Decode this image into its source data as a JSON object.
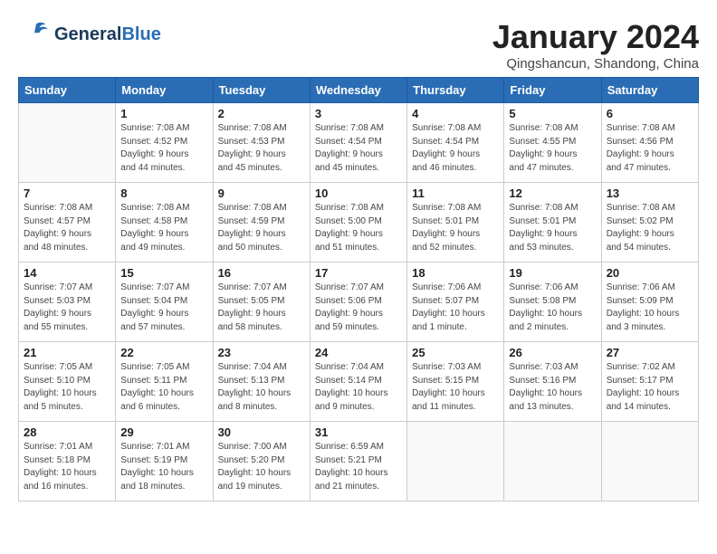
{
  "header": {
    "logo_general": "General",
    "logo_blue": "Blue",
    "month_title": "January 2024",
    "location": "Qingshancun, Shandong, China"
  },
  "days_of_week": [
    "Sunday",
    "Monday",
    "Tuesday",
    "Wednesday",
    "Thursday",
    "Friday",
    "Saturday"
  ],
  "weeks": [
    [
      {
        "day": "",
        "info": ""
      },
      {
        "day": "1",
        "info": "Sunrise: 7:08 AM\nSunset: 4:52 PM\nDaylight: 9 hours\nand 44 minutes."
      },
      {
        "day": "2",
        "info": "Sunrise: 7:08 AM\nSunset: 4:53 PM\nDaylight: 9 hours\nand 45 minutes."
      },
      {
        "day": "3",
        "info": "Sunrise: 7:08 AM\nSunset: 4:54 PM\nDaylight: 9 hours\nand 45 minutes."
      },
      {
        "day": "4",
        "info": "Sunrise: 7:08 AM\nSunset: 4:54 PM\nDaylight: 9 hours\nand 46 minutes."
      },
      {
        "day": "5",
        "info": "Sunrise: 7:08 AM\nSunset: 4:55 PM\nDaylight: 9 hours\nand 47 minutes."
      },
      {
        "day": "6",
        "info": "Sunrise: 7:08 AM\nSunset: 4:56 PM\nDaylight: 9 hours\nand 47 minutes."
      }
    ],
    [
      {
        "day": "7",
        "info": "Sunrise: 7:08 AM\nSunset: 4:57 PM\nDaylight: 9 hours\nand 48 minutes."
      },
      {
        "day": "8",
        "info": "Sunrise: 7:08 AM\nSunset: 4:58 PM\nDaylight: 9 hours\nand 49 minutes."
      },
      {
        "day": "9",
        "info": "Sunrise: 7:08 AM\nSunset: 4:59 PM\nDaylight: 9 hours\nand 50 minutes."
      },
      {
        "day": "10",
        "info": "Sunrise: 7:08 AM\nSunset: 5:00 PM\nDaylight: 9 hours\nand 51 minutes."
      },
      {
        "day": "11",
        "info": "Sunrise: 7:08 AM\nSunset: 5:01 PM\nDaylight: 9 hours\nand 52 minutes."
      },
      {
        "day": "12",
        "info": "Sunrise: 7:08 AM\nSunset: 5:01 PM\nDaylight: 9 hours\nand 53 minutes."
      },
      {
        "day": "13",
        "info": "Sunrise: 7:08 AM\nSunset: 5:02 PM\nDaylight: 9 hours\nand 54 minutes."
      }
    ],
    [
      {
        "day": "14",
        "info": "Sunrise: 7:07 AM\nSunset: 5:03 PM\nDaylight: 9 hours\nand 55 minutes."
      },
      {
        "day": "15",
        "info": "Sunrise: 7:07 AM\nSunset: 5:04 PM\nDaylight: 9 hours\nand 57 minutes."
      },
      {
        "day": "16",
        "info": "Sunrise: 7:07 AM\nSunset: 5:05 PM\nDaylight: 9 hours\nand 58 minutes."
      },
      {
        "day": "17",
        "info": "Sunrise: 7:07 AM\nSunset: 5:06 PM\nDaylight: 9 hours\nand 59 minutes."
      },
      {
        "day": "18",
        "info": "Sunrise: 7:06 AM\nSunset: 5:07 PM\nDaylight: 10 hours\nand 1 minute."
      },
      {
        "day": "19",
        "info": "Sunrise: 7:06 AM\nSunset: 5:08 PM\nDaylight: 10 hours\nand 2 minutes."
      },
      {
        "day": "20",
        "info": "Sunrise: 7:06 AM\nSunset: 5:09 PM\nDaylight: 10 hours\nand 3 minutes."
      }
    ],
    [
      {
        "day": "21",
        "info": "Sunrise: 7:05 AM\nSunset: 5:10 PM\nDaylight: 10 hours\nand 5 minutes."
      },
      {
        "day": "22",
        "info": "Sunrise: 7:05 AM\nSunset: 5:11 PM\nDaylight: 10 hours\nand 6 minutes."
      },
      {
        "day": "23",
        "info": "Sunrise: 7:04 AM\nSunset: 5:13 PM\nDaylight: 10 hours\nand 8 minutes."
      },
      {
        "day": "24",
        "info": "Sunrise: 7:04 AM\nSunset: 5:14 PM\nDaylight: 10 hours\nand 9 minutes."
      },
      {
        "day": "25",
        "info": "Sunrise: 7:03 AM\nSunset: 5:15 PM\nDaylight: 10 hours\nand 11 minutes."
      },
      {
        "day": "26",
        "info": "Sunrise: 7:03 AM\nSunset: 5:16 PM\nDaylight: 10 hours\nand 13 minutes."
      },
      {
        "day": "27",
        "info": "Sunrise: 7:02 AM\nSunset: 5:17 PM\nDaylight: 10 hours\nand 14 minutes."
      }
    ],
    [
      {
        "day": "28",
        "info": "Sunrise: 7:01 AM\nSunset: 5:18 PM\nDaylight: 10 hours\nand 16 minutes."
      },
      {
        "day": "29",
        "info": "Sunrise: 7:01 AM\nSunset: 5:19 PM\nDaylight: 10 hours\nand 18 minutes."
      },
      {
        "day": "30",
        "info": "Sunrise: 7:00 AM\nSunset: 5:20 PM\nDaylight: 10 hours\nand 19 minutes."
      },
      {
        "day": "31",
        "info": "Sunrise: 6:59 AM\nSunset: 5:21 PM\nDaylight: 10 hours\nand 21 minutes."
      },
      {
        "day": "",
        "info": ""
      },
      {
        "day": "",
        "info": ""
      },
      {
        "day": "",
        "info": ""
      }
    ]
  ]
}
